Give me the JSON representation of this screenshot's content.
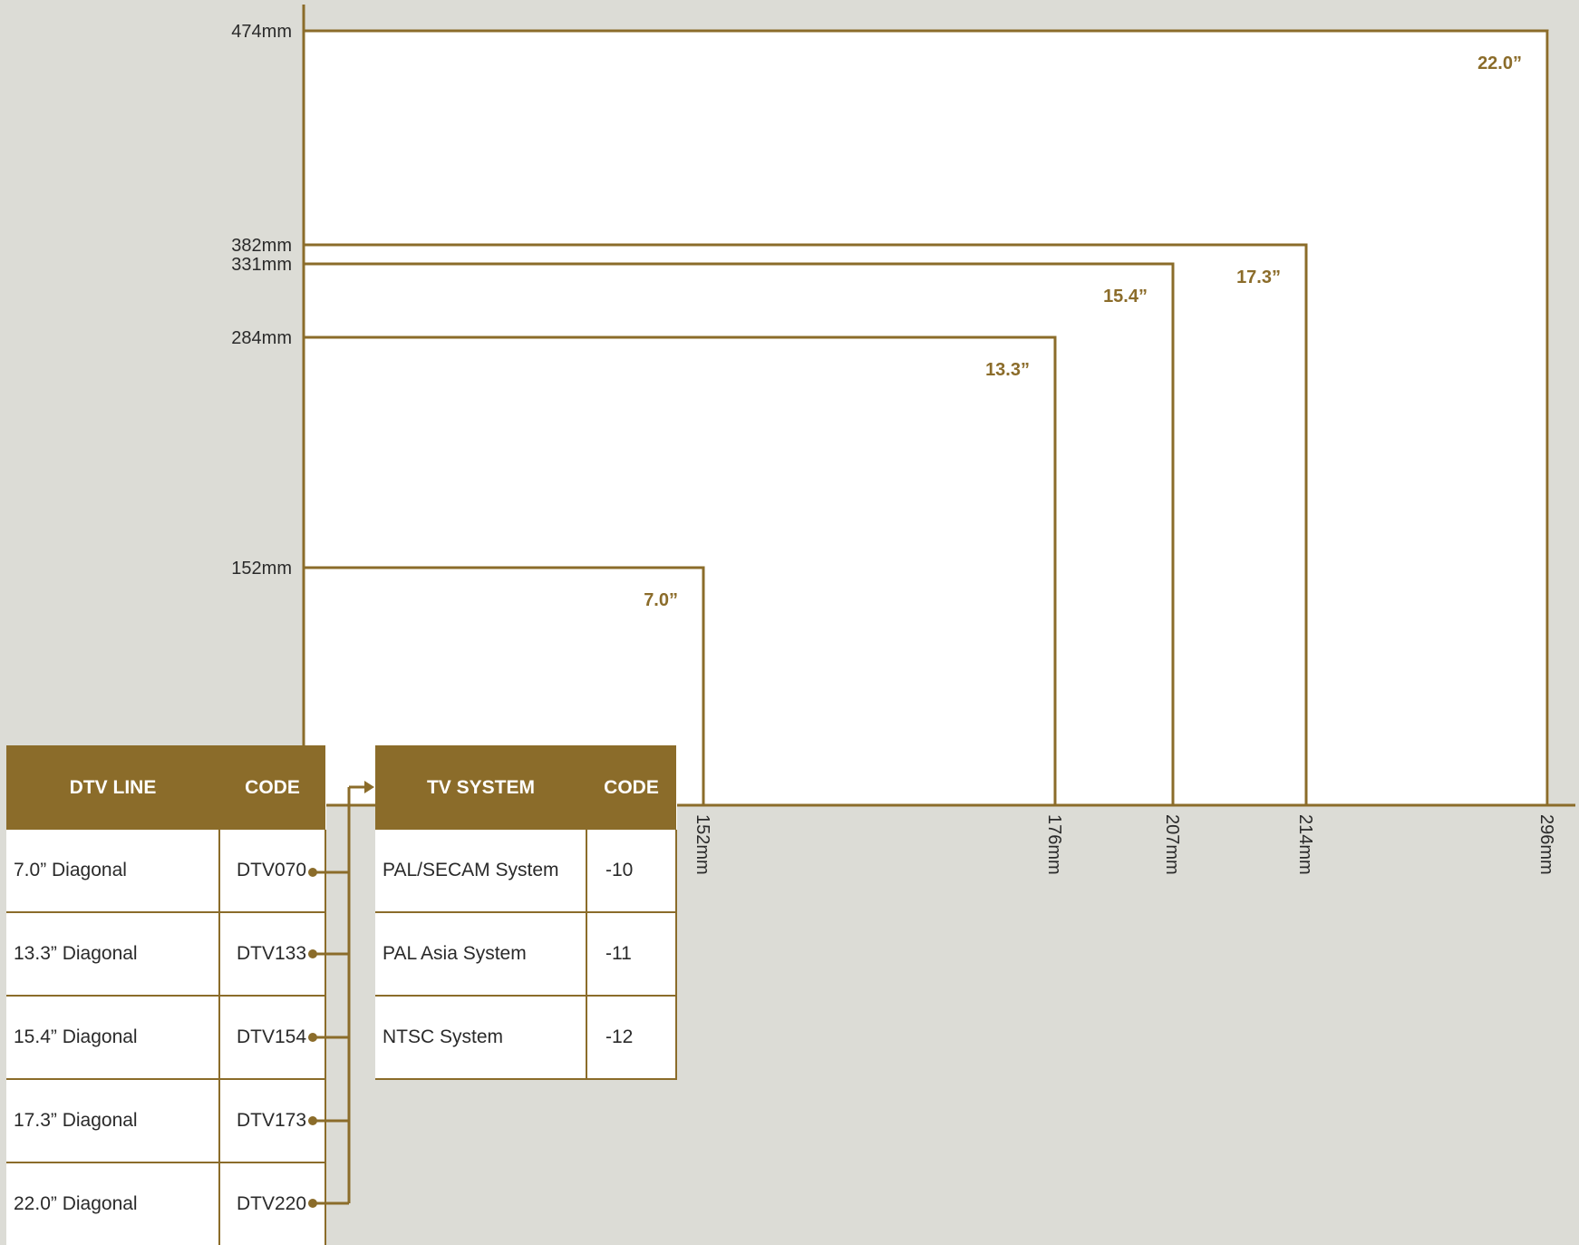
{
  "colors": {
    "accent": "#8b6c2a",
    "background": "#dcdcd6",
    "panel": "#ffffff",
    "text": "#2a2a2a"
  },
  "diagram": {
    "y_ticks": [
      {
        "label": "474mm",
        "value": 474
      },
      {
        "label": "382mm",
        "value": 382
      },
      {
        "label": "331mm",
        "value": 331
      },
      {
        "label": "284mm",
        "value": 284
      },
      {
        "label": "152mm",
        "value": 152
      }
    ],
    "x_ticks": [
      {
        "label": "152mm",
        "value": 152
      },
      {
        "label": "176mm",
        "value": 176
      },
      {
        "label": "207mm",
        "value": 207
      },
      {
        "label": "214mm",
        "value": 214
      },
      {
        "label": "296mm",
        "value": 296
      }
    ],
    "screens": [
      {
        "size": "22.0”",
        "width_mm": 296,
        "height_mm": 474
      },
      {
        "size": "17.3”",
        "width_mm": 214,
        "height_mm": 382
      },
      {
        "size": "15.4”",
        "width_mm": 207,
        "height_mm": 331
      },
      {
        "size": "13.3”",
        "width_mm": 176,
        "height_mm": 284
      },
      {
        "size": "7.0”",
        "width_mm": 152,
        "height_mm": 152
      }
    ]
  },
  "dtv_table": {
    "header_line": "DTV LINE",
    "header_code": "CODE",
    "rows": [
      {
        "line": "7.0” Diagonal",
        "code": "DTV070"
      },
      {
        "line": "13.3” Diagonal",
        "code": "DTV133"
      },
      {
        "line": "15.4” Diagonal",
        "code": "DTV154"
      },
      {
        "line": "17.3” Diagonal",
        "code": "DTV173"
      },
      {
        "line": "22.0” Diagonal",
        "code": "DTV220"
      }
    ]
  },
  "tv_table": {
    "header_system": "TV SYSTEM",
    "header_code": "CODE",
    "rows": [
      {
        "system": "PAL/SECAM System",
        "code": "-10"
      },
      {
        "system": "PAL Asia System",
        "code": "-11"
      },
      {
        "system": "NTSC System",
        "code": "-12"
      }
    ]
  }
}
